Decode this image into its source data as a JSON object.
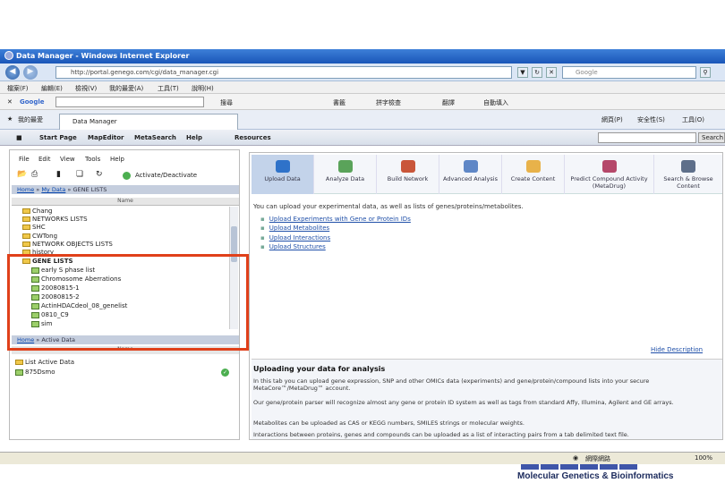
{
  "window": {
    "title": "Data Manager - Windows Internet Explorer"
  },
  "address": {
    "url": "http://portal.genego.com/cgi/data_manager.cgi",
    "search_placeholder": "Google"
  },
  "menu": [
    "檔案(F)",
    "編輯(E)",
    "檢視(V)",
    "我的最愛(A)",
    "工具(T)",
    "說明(H)"
  ],
  "googlebar": {
    "label": "Google",
    "items": [
      "搜尋",
      "書籤",
      "拼字檢查",
      "翻譯",
      "自動填入"
    ]
  },
  "favbar": {
    "favorites": "我的最愛",
    "tab": "Data Manager",
    "right_items": [
      "網頁(P)",
      "安全性(S)",
      "工具(O)"
    ]
  },
  "appnav": {
    "items": [
      "Start Page",
      "MapEditor",
      "MetaSearch",
      "Help",
      "Resources"
    ],
    "search_button": "Search"
  },
  "left": {
    "menu": [
      "File",
      "Edit",
      "View",
      "Tools",
      "Help"
    ],
    "activate": "Activate/Deactivate",
    "crumb1": {
      "home": "Home",
      "mydata": "My Data",
      "current": "GENE LISTS"
    },
    "col_name": "Name",
    "tree": [
      "Chang",
      "NETWORKS LISTS",
      "SHC",
      "CWTong",
      "NETWORK OBJECTS LISTS",
      "history",
      "GENE LISTS",
      "early S phase list",
      "Chromosome Aberrations",
      "20080815-1",
      "20080815-2",
      "ActinHDACdeol_08_genelist",
      "0810_C9",
      "sim"
    ],
    "crumb2": {
      "home": "Home",
      "current": "Active Data"
    },
    "active_header": "Name",
    "active_title": "List Active Data",
    "active_item": "875Dsmo"
  },
  "tools": [
    "Upload Data",
    "Analyze Data",
    "Build Network",
    "Advanced Analysis",
    "Create Content",
    "Predict Compound Activity (MetaDrug)",
    "Search & Browse Content"
  ],
  "intro": "You can upload your experimental data, as well as lists of genes/proteins/metabolites.",
  "uploads": [
    "Upload Experiments with Gene or Protein IDs",
    "Upload Metabolites",
    "Upload Interactions",
    "Upload Structures"
  ],
  "hide": "Hide Description",
  "desc": {
    "title": "Uploading your data for analysis",
    "p1": "In this tab you can upload gene expression, SNP and other OMICs data (experiments) and gene/protein/compound lists into your secure MetaCore™/MetaDrug™ account.",
    "p2": "Our gene/protein parser will recognize almost any gene or protein ID system as well as tags from standard Affy, Illumina, Agilent and GE arrays.",
    "p3": "Metabolites can be uploaded as CAS or KEGG numbers, SMILES strings or molecular weights.",
    "p4": "Interactions between proteins, genes and compounds can be uploaded as a list of interacting pairs from a tab delimited text file."
  },
  "status": {
    "zone": "網際網路",
    "zoom": "100%"
  },
  "footer": "Molecular Genetics & Bioinformatics"
}
